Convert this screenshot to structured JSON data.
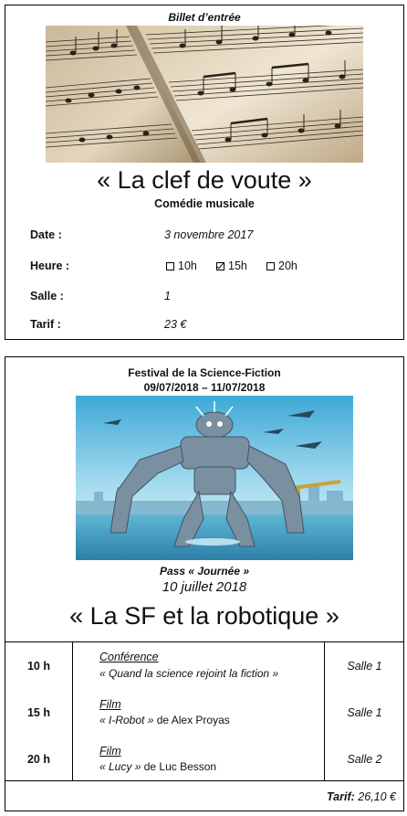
{
  "ticket1": {
    "header": "Billet d’entrée",
    "title": "« La clef de voute »",
    "subtitle": "Comédie musicale",
    "rows": {
      "date": {
        "label": "Date :",
        "value": "3 novembre 2017"
      },
      "heure": {
        "label": "Heure :",
        "options": [
          {
            "label": "10h",
            "checked": false
          },
          {
            "label": "15h",
            "checked": true
          },
          {
            "label": "20h",
            "checked": false
          }
        ]
      },
      "salle": {
        "label": "Salle :",
        "value": "1"
      },
      "tarif": {
        "label": "Tarif :",
        "value": "23 €"
      }
    }
  },
  "ticket2": {
    "header_line1": "Festival de la Science-Fiction",
    "header_line2": "09/07/2018 – 11/07/2018",
    "pass": "Pass « Journée »",
    "date": "10 juillet 2018",
    "title": "« La SF et la robotique »",
    "schedule": [
      {
        "hour": "10 h",
        "type": "Conférence",
        "desc": "« Quand la science rejoint la fiction »",
        "author": "",
        "room": "Salle 1"
      },
      {
        "hour": "15 h",
        "type": "Film",
        "desc": "« I-Robot »",
        "author": " de Alex Proyas",
        "room": "Salle 1"
      },
      {
        "hour": "20 h",
        "type": "Film",
        "desc": "« Lucy »",
        "author": " de Luc Besson",
        "room": "Salle 2"
      }
    ],
    "tarif_label": "Tarif:",
    "tarif_value": " 26,10 €"
  }
}
